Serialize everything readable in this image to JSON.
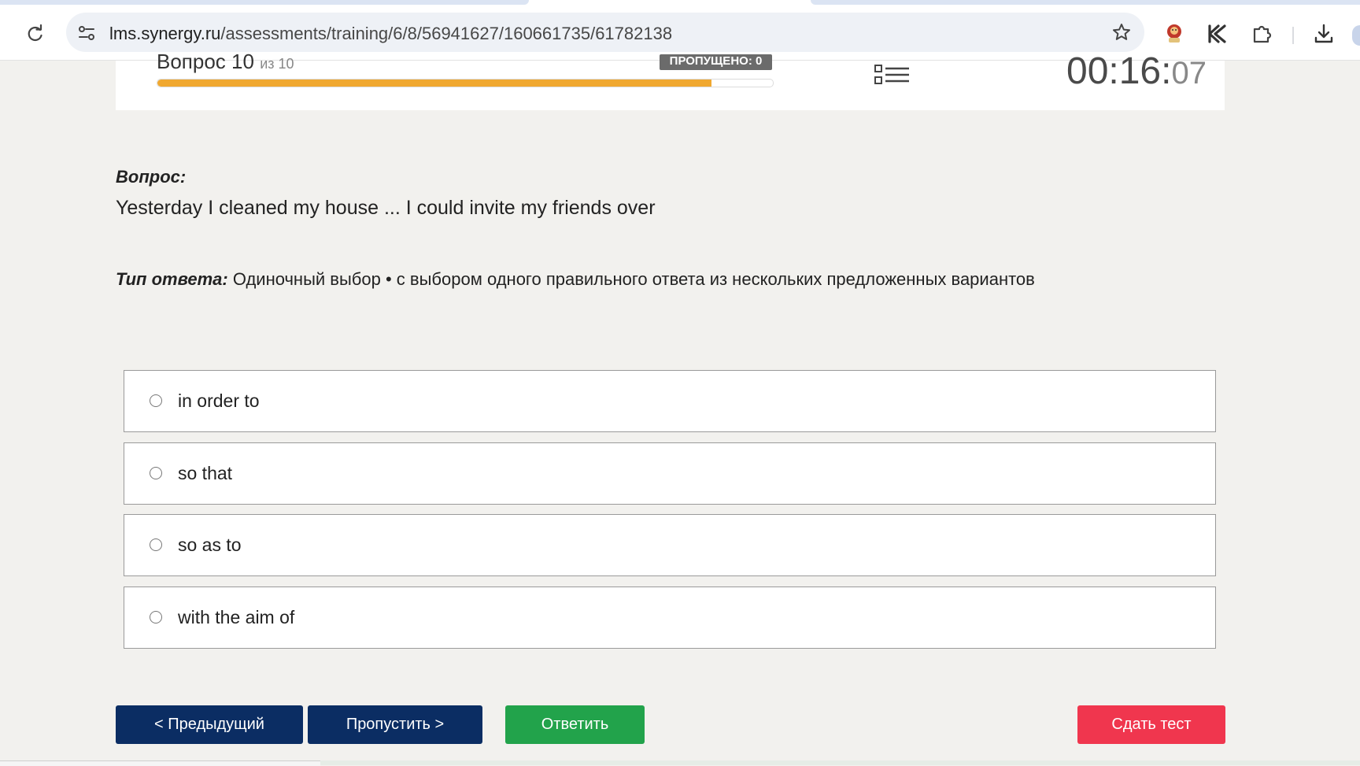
{
  "browser": {
    "url": "lms.synergy.ru/assessments/training/6/8/56941627/160661735/61782138",
    "url_domain": "lms.synergy.ru",
    "url_path": "/assessments/training/6/8/56941627/160661735/61782138"
  },
  "header": {
    "question_word": "Вопрос 10",
    "question_of": "из 10",
    "skipped_badge": "ПРОПУЩЕНО: 0",
    "progress": 0.9,
    "timer_main": "00:16:",
    "timer_seconds": "07"
  },
  "question": {
    "label": "Вопрос:",
    "text": "Yesterday I cleaned my house ... I could invite my friends over",
    "type_label": "Тип ответа:",
    "type_value": " Одиночный выбор • с выбором одного правильного ответа из нескольких предложенных вариантов"
  },
  "options": [
    {
      "label": "in order to"
    },
    {
      "label": "so that"
    },
    {
      "label": "so as to"
    },
    {
      "label": "with the aim of"
    }
  ],
  "buttons": {
    "prev": "< Предыдущий",
    "skip": "Пропустить >",
    "answer": "Ответить",
    "submit": "Сдать тест"
  },
  "colors": {
    "progress_fill": "#f0a830",
    "nav_button": "#0b2d63",
    "answer_button": "#22a34b",
    "submit_button": "#f0364e"
  },
  "icons": [
    "reload-icon",
    "site-info-icon",
    "bookmark-star-icon",
    "extension-avatar-icon",
    "kaspersky-icon",
    "extensions-puzzle-icon",
    "download-icon",
    "question-list-icon"
  ]
}
